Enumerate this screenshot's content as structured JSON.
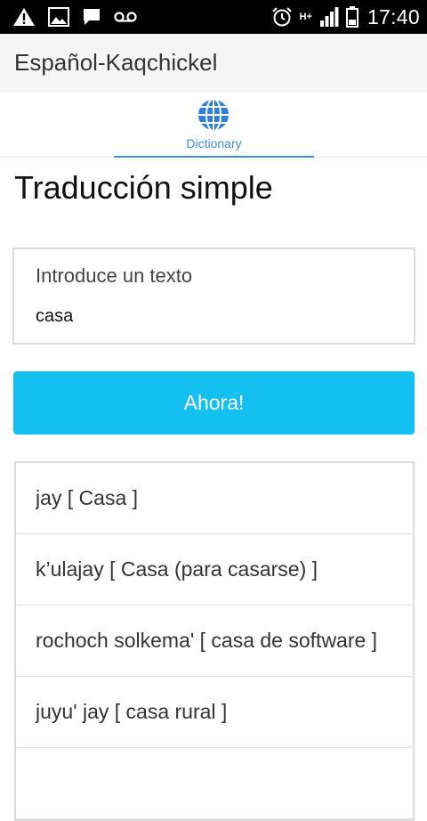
{
  "status_bar": {
    "time": "17:40",
    "network": "H+",
    "left_icons": [
      "warning-icon",
      "image-icon",
      "message-icon",
      "voicemail-icon"
    ],
    "right_icons": [
      "alarm-icon",
      "signal-icon",
      "battery-icon"
    ]
  },
  "app_bar": {
    "title": "Español-Kaqchickel"
  },
  "tabs": [
    {
      "label": "Dictionary",
      "icon": "globe-icon",
      "active": true
    }
  ],
  "page": {
    "title": "Traducción simple"
  },
  "input": {
    "label": "Introduce un texto",
    "value": "casa"
  },
  "button": {
    "label": "Ahora!"
  },
  "results": [
    {
      "text": "jay [ Casa ]"
    },
    {
      "text": "k’ulajay [ Casa (para casarse) ]"
    },
    {
      "text": "rochoch solkema' [ casa de software ]"
    },
    {
      "text": "juyu' jay [ casa rural ]"
    },
    {
      "text": ""
    }
  ],
  "colors": {
    "accent": "#3d8de3",
    "button": "#13c0f0",
    "status_bar": "#000000",
    "app_bar": "#f5f5f5"
  }
}
